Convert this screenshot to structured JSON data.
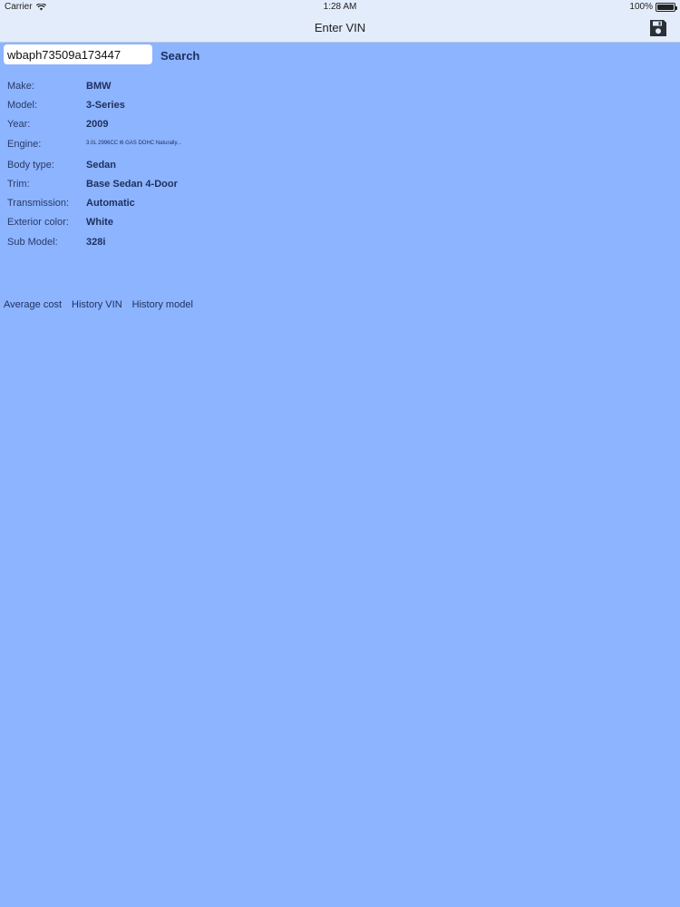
{
  "status_bar": {
    "carrier": "Carrier",
    "time": "1:28 AM",
    "battery": "100%"
  },
  "nav": {
    "title": "Enter VIN",
    "save_icon": "floppy-disk-icon"
  },
  "search": {
    "vin_value": "wbaph73509a173447",
    "button_label": "Search"
  },
  "details": [
    {
      "label": "Make:",
      "value": "BMW"
    },
    {
      "label": "Model:",
      "value": "3-Series"
    },
    {
      "label": "Year:",
      "value": "2009"
    },
    {
      "label": "Engine:",
      "value": "3.0L 2996CC l6 GAS DOHC Naturally..."
    },
    {
      "label": "Body type:",
      "value": "Sedan"
    },
    {
      "label": "Trim:",
      "value": "Base Sedan 4-Door"
    },
    {
      "label": "Transmission:",
      "value": "Automatic"
    },
    {
      "label": "Exterior color:",
      "value": "White"
    },
    {
      "label": "Sub Model:",
      "value": "328i"
    }
  ],
  "links": {
    "average_cost": "Average cost",
    "history_vin": "History VIN",
    "history_model": "History model"
  },
  "colors": {
    "background": "#8cb4ff",
    "nav_background": "#e3ecfb",
    "text": "#1f2f5c"
  }
}
